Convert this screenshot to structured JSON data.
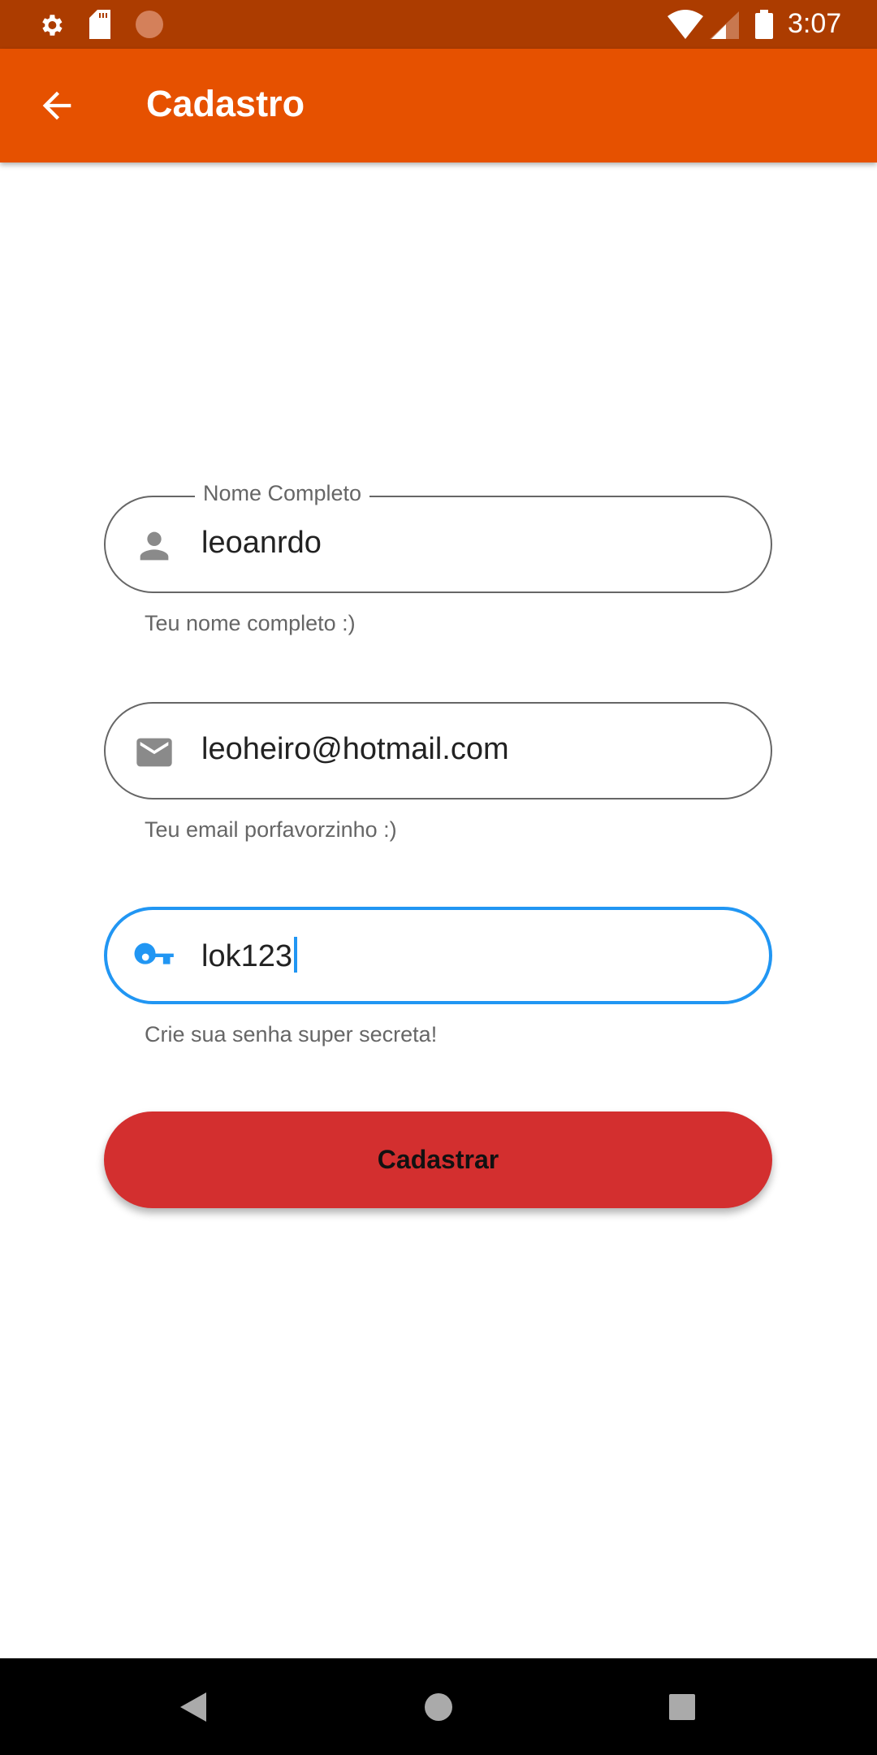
{
  "status_bar": {
    "time": "3:07",
    "icons": [
      "settings-icon",
      "sd-card-icon",
      "sync-icon",
      "wifi-icon",
      "signal-icon",
      "battery-icon"
    ]
  },
  "app_bar": {
    "title": "Cadastro",
    "back_icon": "arrow-back-icon"
  },
  "form": {
    "name": {
      "label": "Nome Completo",
      "value": "leoanrdo",
      "helper": "Teu nome completo :)",
      "icon": "person-icon"
    },
    "email": {
      "value": "leoheiro@hotmail.com",
      "helper": "Teu email porfavorzinho :)",
      "icon": "mail-icon"
    },
    "password": {
      "value": "lok123",
      "helper": "Crie sua senha super secreta!",
      "icon": "key-icon",
      "focused": true
    },
    "submit_label": "Cadastrar"
  },
  "colors": {
    "status_bar": "#ac3c00",
    "app_bar": "#e65100",
    "button": "#d32f2f",
    "focus": "#2196f3"
  },
  "nav_bar": {
    "icons": [
      "back-triangle-icon",
      "home-circle-icon",
      "recents-square-icon"
    ]
  }
}
